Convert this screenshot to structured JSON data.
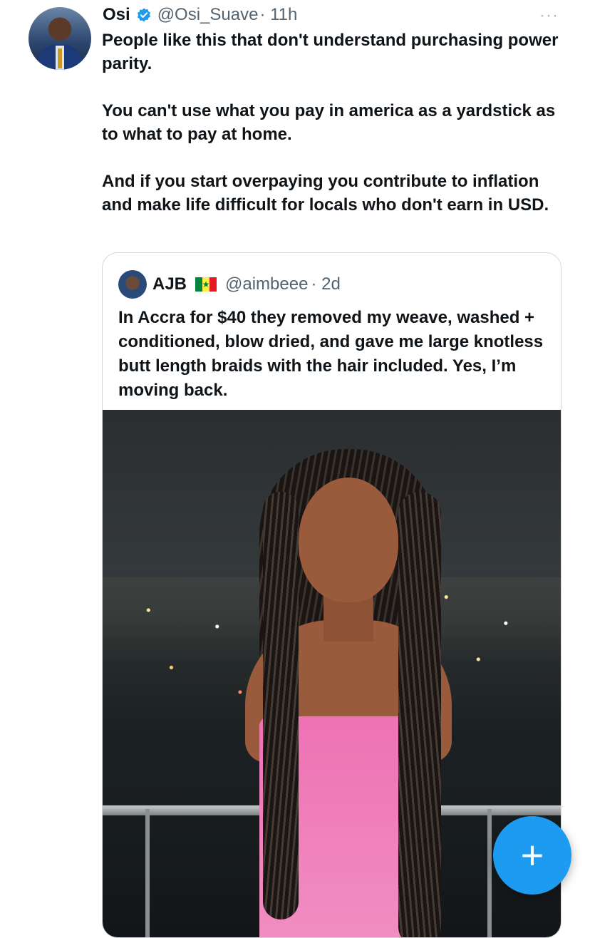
{
  "tweet": {
    "author_name": "Osi",
    "verified": true,
    "handle": "@Osi_Suave",
    "time": "· 11h",
    "more_icon": "···",
    "paragraphs": [
      "People like this that don't understand purchasing power parity.",
      "You can't use what you pay in america as a yardstick as to what to pay at home.",
      "And if you start overpaying you contribute to inflation and make life difficult for locals who don't earn in USD."
    ]
  },
  "quoted_tweet": {
    "author_name": "AJB",
    "flag_icon": "senegal-flag",
    "handle": "@aimbeee",
    "time": "· 2d",
    "text": "In Accra for $40 they removed my weave, washed + conditioned, blow dried, and gave me large knotless butt length braids with the hair included. Yes, I’m moving back."
  },
  "compose_button": {
    "icon": "+"
  },
  "colors": {
    "accent": "#1d9bf0",
    "text": "#0f1419",
    "secondary_text": "#536471",
    "border": "#cfd9de"
  }
}
